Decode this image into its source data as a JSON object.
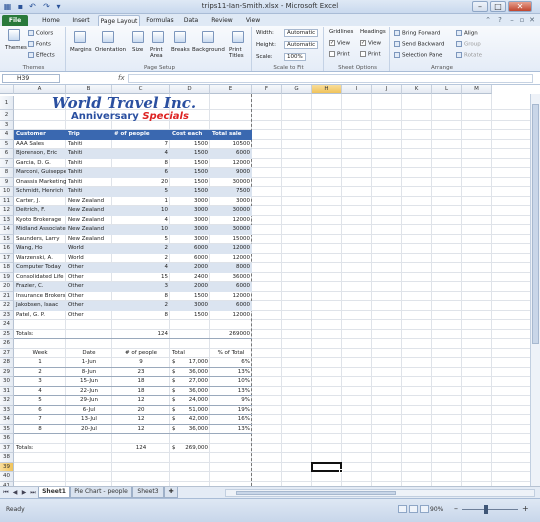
{
  "window": {
    "title": "trips11-Ian-Smith.xlsx - Microsoft Excel",
    "file_tab": "File",
    "tabs": [
      "Home",
      "Insert",
      "Page Layout",
      "Formulas",
      "Data",
      "Review",
      "View"
    ],
    "active_tab": "Page Layout"
  },
  "ribbon": {
    "themes": {
      "themes_label": "Themes",
      "colors": "Colors",
      "fonts": "Fonts",
      "effects": "Effects",
      "group": "Themes"
    },
    "page_setup": {
      "margins": "Margins",
      "orientation": "Orientation",
      "size": "Size",
      "print_area": "Print Area",
      "breaks": "Breaks",
      "background": "Background",
      "print_titles": "Print Titles",
      "group": "Page Setup"
    },
    "scale": {
      "width_label": "Width:",
      "width_value": "Automatic",
      "height_label": "Height:",
      "height_value": "Automatic",
      "scale_label": "Scale:",
      "scale_value": "100%",
      "group": "Scale to Fit"
    },
    "sheet_options": {
      "gridlines": "Gridlines",
      "headings": "Headings",
      "view": "View",
      "print": "Print",
      "group": "Sheet Options"
    },
    "arrange": {
      "bring_forward": "Bring Forward",
      "send_backward": "Send Backward",
      "selection_pane": "Selection Pane",
      "align": "Align",
      "group_btn": "Group",
      "rotate": "Rotate",
      "group": "Arrange"
    }
  },
  "formula_bar": {
    "name_box": "H39",
    "fx": "fx",
    "value": ""
  },
  "columns": [
    "A",
    "B",
    "C",
    "D",
    "E",
    "F",
    "G",
    "H",
    "I",
    "J",
    "K",
    "L",
    "M"
  ],
  "selected_column": "H",
  "selected_row": 39,
  "logo": {
    "line1": "World Travel Inc.",
    "line2a": "Anniversary ",
    "line2b": "Specials"
  },
  "table1": {
    "headers": [
      "Customer",
      "Trip",
      "# of people",
      "Cost each",
      "Total sale"
    ],
    "rows": [
      [
        "AAA Sales",
        "Tahiti",
        "7",
        "1500",
        "10500"
      ],
      [
        "Bjorenson, Eric",
        "Tahiti",
        "4",
        "1500",
        "6000"
      ],
      [
        "Garcia, D. G.",
        "Tahiti",
        "8",
        "1500",
        "12000"
      ],
      [
        "Marconi, Guiseppe",
        "Tahiti",
        "6",
        "1500",
        "9000"
      ],
      [
        "Onassis Marketing",
        "Tahiti",
        "20",
        "1500",
        "30000"
      ],
      [
        "Schmidt, Henrich",
        "Tahiti",
        "5",
        "1500",
        "7500"
      ],
      [
        "Carter, J.",
        "New Zealand",
        "1",
        "3000",
        "3000"
      ],
      [
        "Deitrich, F.",
        "New Zealand",
        "10",
        "3000",
        "30000"
      ],
      [
        "Kyoto Brokerage",
        "New Zealand",
        "4",
        "3000",
        "12000"
      ],
      [
        "Midland Associates",
        "New Zealand",
        "10",
        "3000",
        "30000"
      ],
      [
        "Saunders, Larry",
        "New Zealand",
        "5",
        "3000",
        "15000"
      ],
      [
        "Wang, Ho",
        "World",
        "2",
        "6000",
        "12000"
      ],
      [
        "Warzenski, A.",
        "World",
        "2",
        "6000",
        "12000"
      ],
      [
        "Computer Today",
        "Other",
        "4",
        "2000",
        "8000"
      ],
      [
        "Consolidated Life",
        "Other",
        "15",
        "2400",
        "36000"
      ],
      [
        "Frazier, C.",
        "Other",
        "3",
        "2000",
        "6000"
      ],
      [
        "Insurance Brokers",
        "Other",
        "8",
        "1500",
        "12000"
      ],
      [
        "Jakobsen, Isaac",
        "Other",
        "2",
        "3000",
        "6000"
      ],
      [
        "Patel, G. P.",
        "Other",
        "8",
        "1500",
        "12000"
      ]
    ],
    "totals_label": "Totals:",
    "total_people": "124",
    "total_sale": "269000"
  },
  "table2": {
    "headers": [
      "Week",
      "Date",
      "# of people",
      "Total",
      "% of Total"
    ],
    "rows": [
      [
        "1",
        "1-Jun",
        "9",
        "$",
        "17,000",
        "6%"
      ],
      [
        "2",
        "8-Jun",
        "23",
        "$",
        "36,000",
        "13%"
      ],
      [
        "3",
        "15-Jun",
        "18",
        "$",
        "27,000",
        "10%"
      ],
      [
        "4",
        "22-Jun",
        "18",
        "$",
        "36,000",
        "13%"
      ],
      [
        "5",
        "29-Jun",
        "12",
        "$",
        "24,000",
        "9%"
      ],
      [
        "6",
        "6-Jul",
        "20",
        "$",
        "51,000",
        "19%"
      ],
      [
        "7",
        "13-Jul",
        "12",
        "$",
        "42,000",
        "16%"
      ],
      [
        "8",
        "20-Jul",
        "12",
        "$",
        "36,000",
        "13%"
      ]
    ],
    "totals_label": "Totals:",
    "total_people": "124",
    "total_dollar": "$",
    "total_value": "269,000"
  },
  "sheet_tabs": [
    "Sheet1",
    "Pie Chart - people",
    "Sheet3"
  ],
  "active_sheet": "Sheet1",
  "status": {
    "text": "Ready",
    "zoom": "90%"
  }
}
